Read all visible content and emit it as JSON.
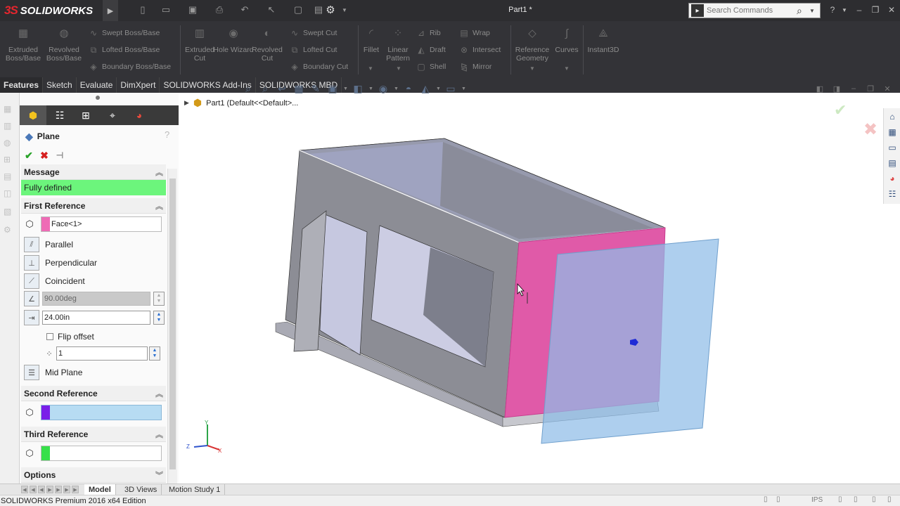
{
  "app": {
    "logo_ds": "3S",
    "logo_name": "SOLIDWORKS",
    "document_title": "Part1 *",
    "search_placeholder": "Search Commands",
    "icons": {
      "new": "new-icon",
      "open": "open-icon",
      "save": "save-icon",
      "print": "print-icon",
      "undo": "undo-icon",
      "select": "select-icon",
      "rebuild": "rebuild-icon",
      "options": "gear-icon"
    }
  },
  "commands": {
    "extruded_boss": "Extruded Boss/Base",
    "revolved_boss": "Revolved Boss/Base",
    "swept_boss": "Swept Boss/Base",
    "lofted_boss": "Lofted Boss/Base",
    "boundary_boss": "Boundary Boss/Base",
    "extruded_cut": "Extruded Cut",
    "hole_wizard": "Hole Wizard",
    "revolved_cut": "Revolved Cut",
    "swept_cut": "Swept Cut",
    "lofted_cut": "Lofted Cut",
    "boundary_cut": "Boundary Cut",
    "fillet": "Fillet",
    "linear_pattern": "Linear Pattern",
    "rib": "Rib",
    "draft": "Draft",
    "shell": "Shell",
    "wrap": "Wrap",
    "intersect": "Intersect",
    "mirror": "Mirror",
    "reference_geometry": "Reference Geometry",
    "curves": "Curves",
    "instant3d": "Instant3D"
  },
  "tabs": [
    "Features",
    "Sketch",
    "Evaluate",
    "DimXpert",
    "SOLIDWORKS Add-Ins",
    "SOLIDWORKS MBD"
  ],
  "property_manager": {
    "title": "Plane",
    "message_header": "Message",
    "message": "Fully defined",
    "first_reference": {
      "header": "First Reference",
      "value": "Face<1>",
      "options": [
        "Parallel",
        "Perpendicular",
        "Coincident"
      ],
      "angle": "90.00deg",
      "distance": "24.00in",
      "flip_offset": "Flip offset",
      "count": "1",
      "mid_plane": "Mid Plane",
      "color": "#ee6bb5"
    },
    "second_reference": {
      "header": "Second Reference",
      "color": "#7a1fe8",
      "fill": "#b7dcf3"
    },
    "third_reference": {
      "header": "Third Reference",
      "color": "#37e04a"
    },
    "options_header": "Options"
  },
  "tree": {
    "item": "Part1  (Default<<Default>..."
  },
  "bottom_tabs": [
    "Model",
    "3D Views",
    "Motion Study 1"
  ],
  "status": {
    "edition": "SOLIDWORKS Premium 2016 x64 Edition",
    "units": "IPS"
  },
  "colors": {
    "titlebar": "#2d2d30",
    "selected_face": "#e05aa8",
    "plane_preview": "#8fbde8",
    "message_ok": "#6cf57c"
  }
}
